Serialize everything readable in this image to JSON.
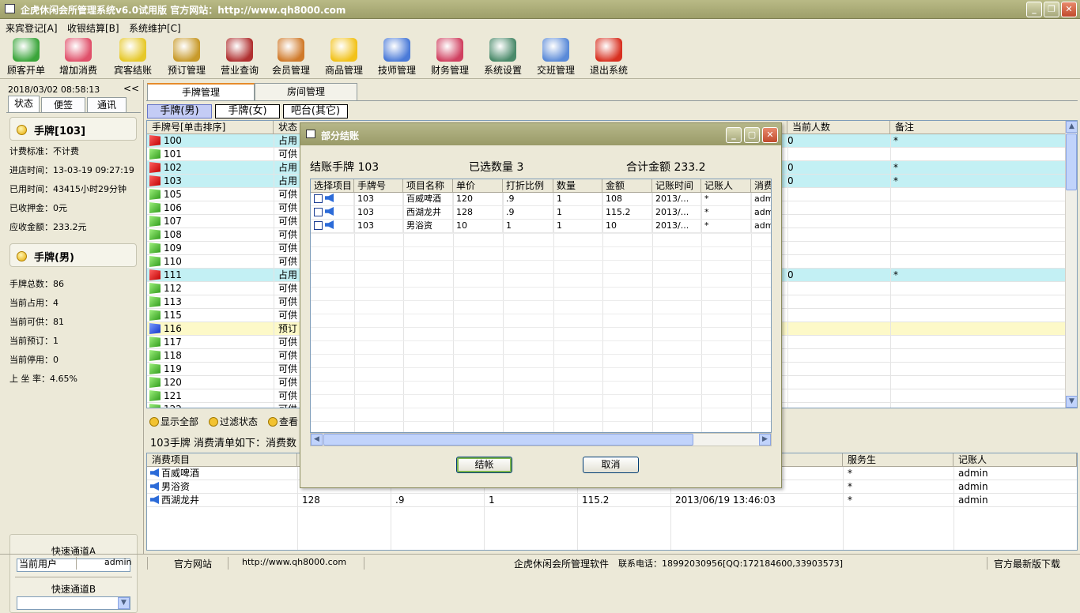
{
  "window": {
    "title": "企虎休闲会所管理系统v6.0试用版  官方网站：http://www.qh8000.com",
    "min_label": "_",
    "max_label": "❐",
    "close_label": "✕"
  },
  "menubar": [
    "来宾登记[A]",
    "收银结算[B]",
    "系统维护[C]"
  ],
  "toolbar": [
    {
      "label": "顾客开单",
      "icon": "customer-icon",
      "color": "#3aa53a"
    },
    {
      "label": "增加消费",
      "icon": "add-heart-icon",
      "color": "#e0506a"
    },
    {
      "label": "宾客结账",
      "icon": "checkout-arrow-icon",
      "color": "#e6c82a"
    },
    {
      "label": "预订管理",
      "icon": "alarm-clock-icon",
      "color": "#c89a2a"
    },
    {
      "label": "营业查询",
      "icon": "query-icon",
      "color": "#b03030"
    },
    {
      "label": "会员管理",
      "icon": "members-icon",
      "color": "#d07a2a"
    },
    {
      "label": "商品管理",
      "icon": "star-icon",
      "color": "#f2c21a"
    },
    {
      "label": "技师管理",
      "icon": "technicians-icon",
      "color": "#4a7ad8"
    },
    {
      "label": "财务管理",
      "icon": "finance-icon",
      "color": "#d04060"
    },
    {
      "label": "系统设置",
      "icon": "settings-icon",
      "color": "#4a8a6a"
    },
    {
      "label": "交班管理",
      "icon": "handshake-icon",
      "color": "#5a8ad8"
    },
    {
      "label": "退出系统",
      "icon": "power-icon",
      "color": "#d83020"
    }
  ],
  "left": {
    "datetime": "2018/03/02  08:58:13",
    "collapse": "<<",
    "tabs": [
      "状态",
      "便签",
      "通讯"
    ],
    "card1_title": "手牌[103]",
    "card1_rows": [
      "计费标准：不计费",
      "进店时间：13-03-19 09:27:19",
      "已用时间：43415小时29分钟",
      "已收押金：0元",
      "应收金额：233.2元"
    ],
    "card2_title": "手牌(男)",
    "card2_rows": [
      "手牌总数：86",
      "当前占用：4",
      "当前可供：81",
      "当前预订：1",
      "当前停用：0",
      "上 坐 率：4.65%"
    ],
    "quick_a": "快速通道A",
    "quick_b": "快速通道B"
  },
  "main_tabs": [
    "手牌管理",
    "房间管理"
  ],
  "sub_tabs": [
    "手牌(男)",
    "手牌(女)",
    "吧台(其它)"
  ],
  "grid": {
    "headers": [
      "手牌号[单击排序]",
      "状态",
      "当前人数",
      "备注"
    ],
    "rows": [
      {
        "id": "100",
        "status": "占用",
        "flag": "red",
        "people": "0",
        "note": "*"
      },
      {
        "id": "101",
        "status": "可供",
        "flag": "green",
        "people": "",
        "note": ""
      },
      {
        "id": "102",
        "status": "占用",
        "flag": "red",
        "people": "0",
        "note": "*"
      },
      {
        "id": "103",
        "status": "占用",
        "flag": "red",
        "people": "0",
        "note": "*"
      },
      {
        "id": "105",
        "status": "可供",
        "flag": "green",
        "people": "",
        "note": ""
      },
      {
        "id": "106",
        "status": "可供",
        "flag": "green",
        "people": "",
        "note": ""
      },
      {
        "id": "107",
        "status": "可供",
        "flag": "green",
        "people": "",
        "note": ""
      },
      {
        "id": "108",
        "status": "可供",
        "flag": "green",
        "people": "",
        "note": ""
      },
      {
        "id": "109",
        "status": "可供",
        "flag": "green",
        "people": "",
        "note": ""
      },
      {
        "id": "110",
        "status": "可供",
        "flag": "green",
        "people": "",
        "note": ""
      },
      {
        "id": "111",
        "status": "占用",
        "flag": "red",
        "people": "0",
        "note": "*"
      },
      {
        "id": "112",
        "status": "可供",
        "flag": "green",
        "people": "",
        "note": ""
      },
      {
        "id": "113",
        "status": "可供",
        "flag": "green",
        "people": "",
        "note": ""
      },
      {
        "id": "115",
        "status": "可供",
        "flag": "green",
        "people": "",
        "note": ""
      },
      {
        "id": "116",
        "status": "预订",
        "flag": "blue",
        "people": "",
        "note": ""
      },
      {
        "id": "117",
        "status": "可供",
        "flag": "green",
        "people": "",
        "note": ""
      },
      {
        "id": "118",
        "status": "可供",
        "flag": "green",
        "people": "",
        "note": ""
      },
      {
        "id": "119",
        "status": "可供",
        "flag": "green",
        "people": "",
        "note": ""
      },
      {
        "id": "120",
        "status": "可供",
        "flag": "green",
        "people": "",
        "note": ""
      },
      {
        "id": "121",
        "status": "可供",
        "flag": "green",
        "people": "",
        "note": ""
      },
      {
        "id": "122",
        "status": "可供",
        "flag": "green",
        "people": "",
        "note": ""
      }
    ]
  },
  "filters": [
    "显示全部",
    "过滤状态",
    "查看"
  ],
  "detail": {
    "title": "103手牌  消费清单如下：消费数",
    "headers": [
      "消费项目",
      "服务生",
      "记账人"
    ],
    "rows": [
      {
        "item": "百威啤酒",
        "c1": "",
        "c2": "",
        "c3": "",
        "c4": "",
        "c5": "",
        "waiter": "*",
        "recorder": "admin"
      },
      {
        "item": "男浴资",
        "c1": "",
        "c2": "",
        "c3": "",
        "c4": "",
        "c5": "",
        "waiter": "*",
        "recorder": "admin"
      },
      {
        "item": "西湖龙井",
        "c1": "128",
        "c2": ".9",
        "c3": "1",
        "c4": "115.2",
        "c5": "2013/06/19 13:46:03",
        "waiter": "*",
        "recorder": "admin"
      }
    ]
  },
  "statusbar": {
    "user_label": "当前用户",
    "user": "admin",
    "site_label": "官方网站",
    "site": "http://www.qh8000.com",
    "software": "企虎休闲会所管理软件",
    "phone": "联系电话：18992030956[QQ:172184600,33903573]",
    "download": "官方最新版下载"
  },
  "modal": {
    "title": "部分结账",
    "summary_card": "结账手牌 103",
    "summary_count": "已选数量 3",
    "summary_total": "合计金额 233.2",
    "headers": [
      "选择项目",
      "手牌号",
      "项目名称",
      "单价",
      "打折比例",
      "数量",
      "金额",
      "记账时间",
      "记账人",
      "消费"
    ],
    "rows": [
      {
        "card": "103",
        "name": "百威啤酒",
        "price": "120",
        "discount": ".9",
        "qty": "1",
        "amount": "108",
        "time": "2013/...",
        "recorder": "*",
        "extra": "adm"
      },
      {
        "card": "103",
        "name": "西湖龙井",
        "price": "128",
        "discount": ".9",
        "qty": "1",
        "amount": "115.2",
        "time": "2013/...",
        "recorder": "*",
        "extra": "adm"
      },
      {
        "card": "103",
        "name": "男浴资",
        "price": "10",
        "discount": "1",
        "qty": "1",
        "amount": "10",
        "time": "2013/...",
        "recorder": "*",
        "extra": "adm"
      }
    ],
    "ok_label": "结帐",
    "cancel_label": "取消"
  }
}
